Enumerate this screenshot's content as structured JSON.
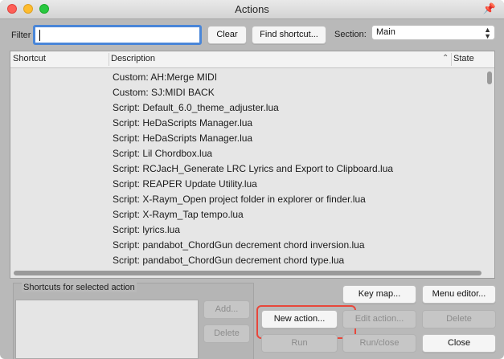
{
  "window": {
    "title": "Actions"
  },
  "toolbar": {
    "filter_label": "Filter",
    "filter_value": "",
    "clear_label": "Clear",
    "find_shortcut_label": "Find shortcut...",
    "section_label": "Section:",
    "section_value": "Main"
  },
  "table": {
    "columns": [
      "Shortcut",
      "Description",
      "State"
    ],
    "rows": [
      "Custom: AH:Merge MIDI",
      "Custom: SJ:MIDI BACK",
      "Script: Default_6.0_theme_adjuster.lua",
      "Script: HeDaScripts Manager.lua",
      "Script: HeDaScripts Manager.lua",
      "Script: Lil Chordbox.lua",
      "Script: RCJacH_Generate LRC Lyrics and Export to Clipboard.lua",
      "Script: REAPER Update Utility.lua",
      "Script: X-Raym_Open project folder in explorer or finder.lua",
      "Script: X-Raym_Tap tempo.lua",
      "Script: lyrics.lua",
      "Script: pandabot_ChordGun decrement chord inversion.lua",
      "Script: pandabot_ChordGun decrement chord type.lua"
    ]
  },
  "shortcuts_panel": {
    "label": "Shortcuts for selected action",
    "add_label": "Add...",
    "delete_label": "Delete"
  },
  "actions": {
    "key_map_label": "Key map...",
    "menu_editor_label": "Menu editor...",
    "new_action_label": "New action...",
    "edit_action_label": "Edit action...",
    "delete_label": "Delete",
    "run_label": "Run",
    "run_close_label": "Run/close",
    "close_label": "Close"
  },
  "colors": {
    "highlight": "#e8473b",
    "focus": "#4a86d8"
  }
}
